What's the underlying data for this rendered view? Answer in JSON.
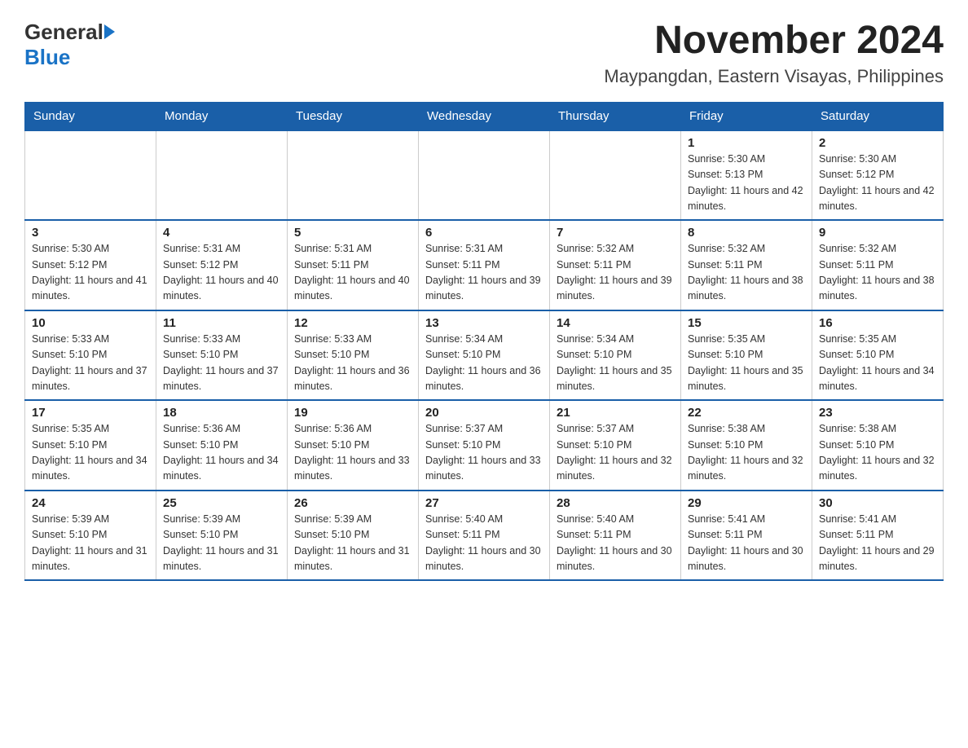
{
  "header": {
    "logo_general": "General",
    "logo_blue": "Blue",
    "month_title": "November 2024",
    "location": "Maypangdan, Eastern Visayas, Philippines"
  },
  "days_of_week": [
    "Sunday",
    "Monday",
    "Tuesday",
    "Wednesday",
    "Thursday",
    "Friday",
    "Saturday"
  ],
  "weeks": [
    [
      {
        "day": "",
        "info": ""
      },
      {
        "day": "",
        "info": ""
      },
      {
        "day": "",
        "info": ""
      },
      {
        "day": "",
        "info": ""
      },
      {
        "day": "",
        "info": ""
      },
      {
        "day": "1",
        "info": "Sunrise: 5:30 AM\nSunset: 5:13 PM\nDaylight: 11 hours and 42 minutes."
      },
      {
        "day": "2",
        "info": "Sunrise: 5:30 AM\nSunset: 5:12 PM\nDaylight: 11 hours and 42 minutes."
      }
    ],
    [
      {
        "day": "3",
        "info": "Sunrise: 5:30 AM\nSunset: 5:12 PM\nDaylight: 11 hours and 41 minutes."
      },
      {
        "day": "4",
        "info": "Sunrise: 5:31 AM\nSunset: 5:12 PM\nDaylight: 11 hours and 40 minutes."
      },
      {
        "day": "5",
        "info": "Sunrise: 5:31 AM\nSunset: 5:11 PM\nDaylight: 11 hours and 40 minutes."
      },
      {
        "day": "6",
        "info": "Sunrise: 5:31 AM\nSunset: 5:11 PM\nDaylight: 11 hours and 39 minutes."
      },
      {
        "day": "7",
        "info": "Sunrise: 5:32 AM\nSunset: 5:11 PM\nDaylight: 11 hours and 39 minutes."
      },
      {
        "day": "8",
        "info": "Sunrise: 5:32 AM\nSunset: 5:11 PM\nDaylight: 11 hours and 38 minutes."
      },
      {
        "day": "9",
        "info": "Sunrise: 5:32 AM\nSunset: 5:11 PM\nDaylight: 11 hours and 38 minutes."
      }
    ],
    [
      {
        "day": "10",
        "info": "Sunrise: 5:33 AM\nSunset: 5:10 PM\nDaylight: 11 hours and 37 minutes."
      },
      {
        "day": "11",
        "info": "Sunrise: 5:33 AM\nSunset: 5:10 PM\nDaylight: 11 hours and 37 minutes."
      },
      {
        "day": "12",
        "info": "Sunrise: 5:33 AM\nSunset: 5:10 PM\nDaylight: 11 hours and 36 minutes."
      },
      {
        "day": "13",
        "info": "Sunrise: 5:34 AM\nSunset: 5:10 PM\nDaylight: 11 hours and 36 minutes."
      },
      {
        "day": "14",
        "info": "Sunrise: 5:34 AM\nSunset: 5:10 PM\nDaylight: 11 hours and 35 minutes."
      },
      {
        "day": "15",
        "info": "Sunrise: 5:35 AM\nSunset: 5:10 PM\nDaylight: 11 hours and 35 minutes."
      },
      {
        "day": "16",
        "info": "Sunrise: 5:35 AM\nSunset: 5:10 PM\nDaylight: 11 hours and 34 minutes."
      }
    ],
    [
      {
        "day": "17",
        "info": "Sunrise: 5:35 AM\nSunset: 5:10 PM\nDaylight: 11 hours and 34 minutes."
      },
      {
        "day": "18",
        "info": "Sunrise: 5:36 AM\nSunset: 5:10 PM\nDaylight: 11 hours and 34 minutes."
      },
      {
        "day": "19",
        "info": "Sunrise: 5:36 AM\nSunset: 5:10 PM\nDaylight: 11 hours and 33 minutes."
      },
      {
        "day": "20",
        "info": "Sunrise: 5:37 AM\nSunset: 5:10 PM\nDaylight: 11 hours and 33 minutes."
      },
      {
        "day": "21",
        "info": "Sunrise: 5:37 AM\nSunset: 5:10 PM\nDaylight: 11 hours and 32 minutes."
      },
      {
        "day": "22",
        "info": "Sunrise: 5:38 AM\nSunset: 5:10 PM\nDaylight: 11 hours and 32 minutes."
      },
      {
        "day": "23",
        "info": "Sunrise: 5:38 AM\nSunset: 5:10 PM\nDaylight: 11 hours and 32 minutes."
      }
    ],
    [
      {
        "day": "24",
        "info": "Sunrise: 5:39 AM\nSunset: 5:10 PM\nDaylight: 11 hours and 31 minutes."
      },
      {
        "day": "25",
        "info": "Sunrise: 5:39 AM\nSunset: 5:10 PM\nDaylight: 11 hours and 31 minutes."
      },
      {
        "day": "26",
        "info": "Sunrise: 5:39 AM\nSunset: 5:10 PM\nDaylight: 11 hours and 31 minutes."
      },
      {
        "day": "27",
        "info": "Sunrise: 5:40 AM\nSunset: 5:11 PM\nDaylight: 11 hours and 30 minutes."
      },
      {
        "day": "28",
        "info": "Sunrise: 5:40 AM\nSunset: 5:11 PM\nDaylight: 11 hours and 30 minutes."
      },
      {
        "day": "29",
        "info": "Sunrise: 5:41 AM\nSunset: 5:11 PM\nDaylight: 11 hours and 30 minutes."
      },
      {
        "day": "30",
        "info": "Sunrise: 5:41 AM\nSunset: 5:11 PM\nDaylight: 11 hours and 29 minutes."
      }
    ]
  ]
}
